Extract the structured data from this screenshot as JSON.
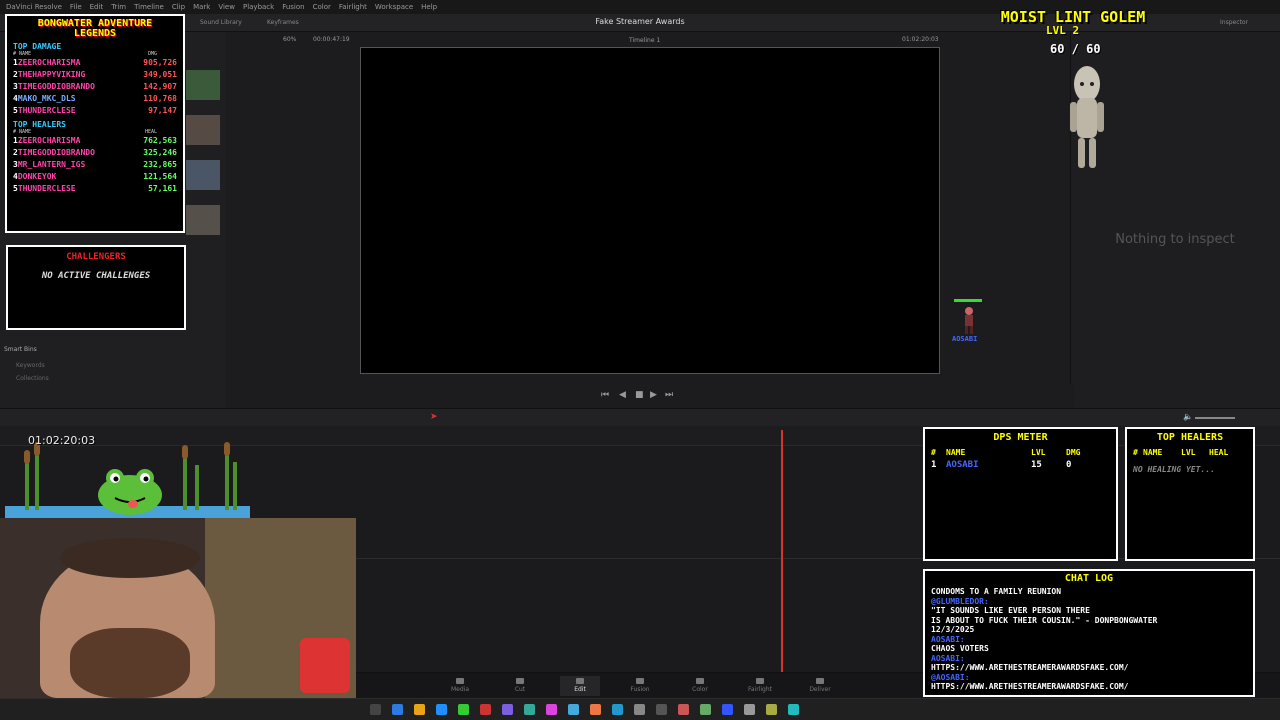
{
  "app": {
    "menu": [
      "DaVinci Resolve",
      "File",
      "Edit",
      "Trim",
      "Timeline",
      "Clip",
      "Mark",
      "View",
      "Playback",
      "Fusion",
      "Color",
      "Fairlight",
      "Workspace",
      "Help"
    ],
    "project_title": "Fake Streamer Awards",
    "tabs": {
      "sound_library": "Sound Library",
      "keyframes": "Keyframes",
      "inspector": "Inspector"
    },
    "zoom": "60%",
    "source_timecode": "00:00:47:19",
    "timeline_name": "Timeline 1",
    "record_timecode": "01:02:20:03",
    "inspector_empty": "Nothing to inspect",
    "smart_bins": "Smart Bins",
    "keywords": "Keywords",
    "collections": "Collections",
    "timeline_timecode": "01:02:20:03",
    "pages": [
      "Media",
      "Cut",
      "Edit",
      "Fusion",
      "Color",
      "Fairlight",
      "Deliver"
    ],
    "active_page": "Edit"
  },
  "overlay": {
    "leaderboard": {
      "title_line1": "BONGWATER ADVENTURE",
      "title_line2": "LEGENDS",
      "damage_title": "TOP DAMAGE",
      "damage_hdr": {
        "rank": "#",
        "name": "NAME",
        "val": "DMG"
      },
      "damage": [
        {
          "rank": "1",
          "name": "ZEEROCHARISMA",
          "val": "905,726"
        },
        {
          "rank": "2",
          "name": "THEHAPPYVIKING",
          "val": "349,051"
        },
        {
          "rank": "3",
          "name": "TIMEGODDIOBRANDO",
          "val": "142,907"
        },
        {
          "rank": "4",
          "name": "MAKO_MKC_DLS",
          "val": "110,768"
        },
        {
          "rank": "5",
          "name": "THUNDERCLESE",
          "val": "97,147"
        }
      ],
      "heal_title": "TOP HEALERS",
      "heal_hdr": {
        "rank": "#",
        "name": "NAME",
        "val": "HEAL"
      },
      "healers": [
        {
          "rank": "1",
          "name": "ZEEROCHARISMA",
          "val": "762,563"
        },
        {
          "rank": "2",
          "name": "TIMEGODDIOBRANDO",
          "val": "325,246"
        },
        {
          "rank": "3",
          "name": "MR_LANTERN_IGS",
          "val": "232,865"
        },
        {
          "rank": "4",
          "name": "DONKEYOK",
          "val": "121,564"
        },
        {
          "rank": "5",
          "name": "THUNDERCLESE",
          "val": "57,161"
        }
      ]
    },
    "challengers": {
      "title": "CHALLENGERS",
      "empty": "NO ACTIVE CHALLENGES"
    },
    "boss": {
      "name": "MOIST LINT GOLEM",
      "level": "LVL 2",
      "hp": "60 / 60"
    },
    "player_tag": "AOSABI",
    "dps_meter": {
      "title": "DPS METER",
      "headers": [
        "#",
        "NAME",
        "LVL",
        "DMG"
      ],
      "rows": [
        {
          "rank": "1",
          "name": "AOSABI",
          "lvl": "15",
          "dmg": "0"
        }
      ]
    },
    "top_healers_panel": {
      "title": "TOP HEALERS",
      "headers": [
        "#",
        "NAME",
        "LVL",
        "HEAL"
      ],
      "empty": "NO HEALING YET..."
    },
    "chat": {
      "title": "CHAT LOG",
      "lines": [
        {
          "t": "CONDOMS TO A FAMILY REUNION",
          "u": false
        },
        {
          "t": "@GLUMBLEDOR:",
          "u": true
        },
        {
          "t": "\"IT SOUNDS LIKE EVER PERSON THERE",
          "u": false
        },
        {
          "t": "IS ABOUT TO FUCK THEIR COUSIN.\" - DONPBONGWATER",
          "u": false
        },
        {
          "t": "12/3/2025",
          "u": false
        },
        {
          "t": "AOSABI:",
          "u": true
        },
        {
          "t": "CHAOS VOTERS",
          "u": false
        },
        {
          "t": "AOSABI:",
          "u": true
        },
        {
          "t": "HTTPS://WWW.ARETHESTREAMERAWARDSFAKE.COM/",
          "u": false
        },
        {
          "t": "@AOSABI:",
          "u": true
        },
        {
          "t": "HTTPS://WWW.ARETHESTREAMERAWARDSFAKE.COM/",
          "u": false
        }
      ]
    }
  },
  "colors": {
    "playhead": "#d9342b",
    "arcade_yellow": "#ffff00",
    "arcade_cyan": "#33ccff"
  }
}
